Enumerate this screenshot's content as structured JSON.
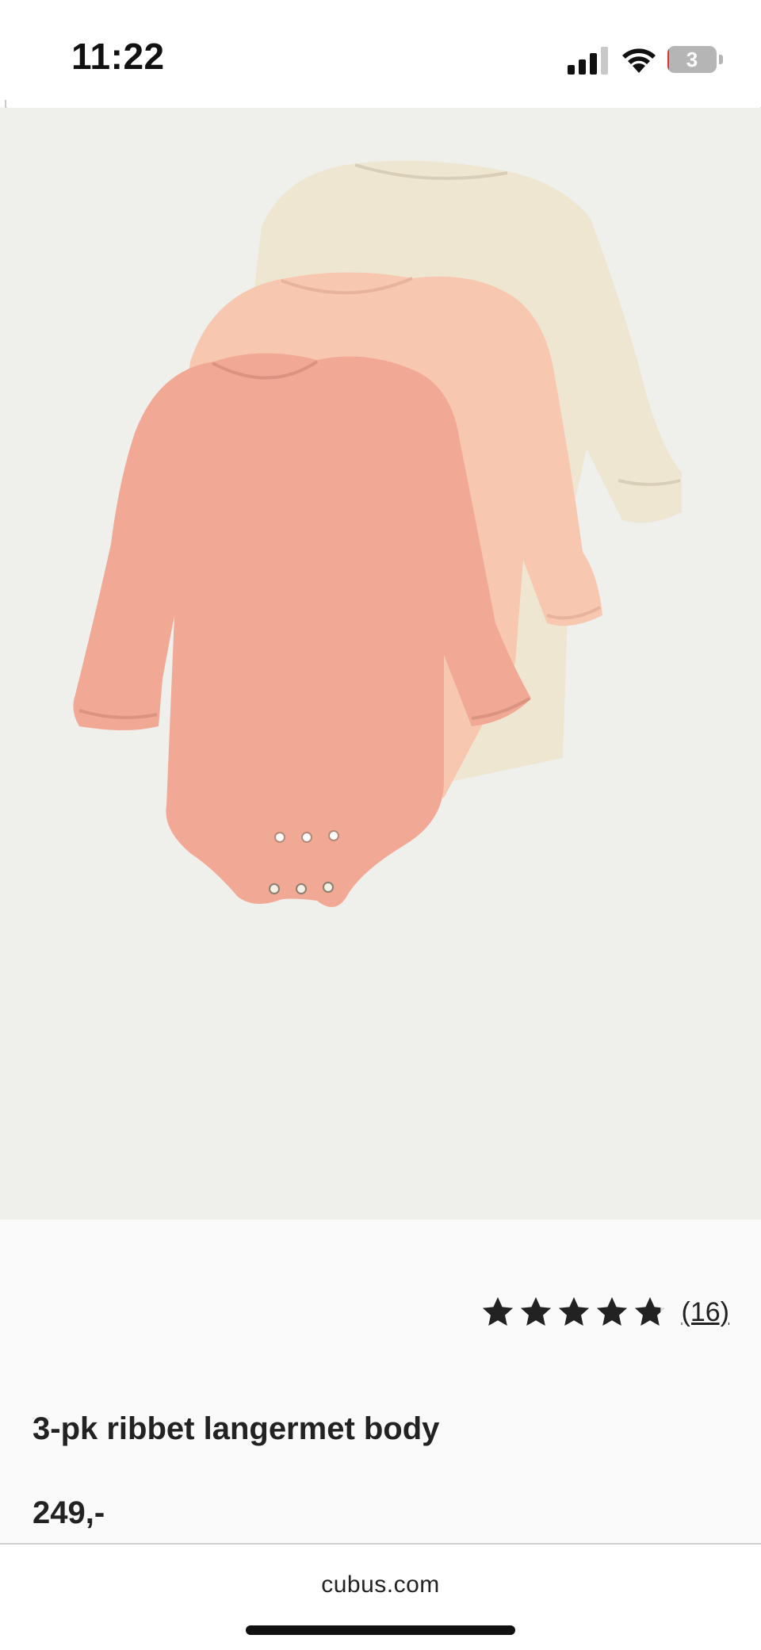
{
  "status_bar": {
    "time": "11:22",
    "battery_level": "3",
    "battery_fraction": 0.03,
    "icons": [
      "signal-icon",
      "wifi-icon",
      "battery-icon"
    ]
  },
  "gallery": {
    "image": "product-photo-3-bodysuits",
    "slide_count": 3,
    "active_slide": 1,
    "background_color": "#efefec"
  },
  "product": {
    "rating": 4.8,
    "rating_max": 5,
    "review_count": "(16)",
    "title": "3-pk ribbet langermet body",
    "price": "249,-"
  },
  "browser": {
    "url": "cubus.com"
  },
  "colors": {
    "bodysuit_front": "#f1a996",
    "bodysuit_middle": "#f7c7b0",
    "bodysuit_back": "#efe6d2",
    "star": "#222222"
  }
}
